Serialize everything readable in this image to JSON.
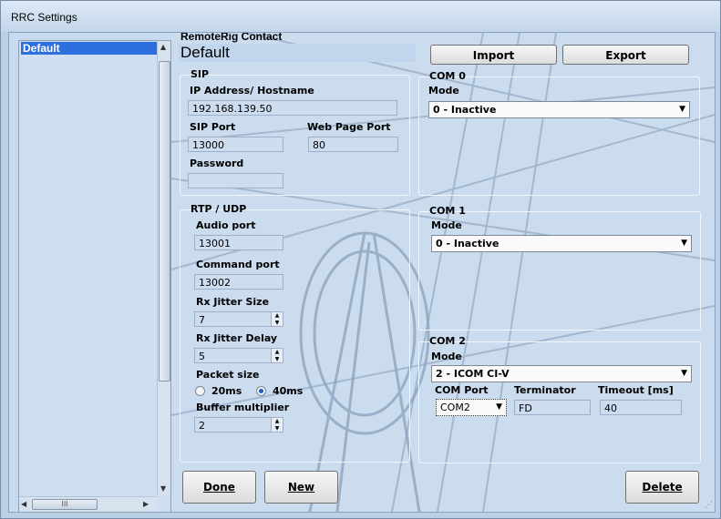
{
  "window": {
    "title": "RRC Settings"
  },
  "list": {
    "items": [
      {
        "label": "Default",
        "selected": true
      }
    ],
    "hscroll_glyph": "III"
  },
  "header": {
    "contact_label": "RemoteRig Contact",
    "profile_name": "Default"
  },
  "buttons": {
    "import": "Import",
    "export": "Export",
    "done": "Done",
    "new": "New",
    "delete": "Delete"
  },
  "sip": {
    "title": "SIP",
    "ip_label": "IP Address/ Hostname",
    "ip_value": "192.168.139.50",
    "sip_port_label": "SIP Port",
    "sip_port_value": "13000",
    "web_port_label": "Web Page Port",
    "web_port_value": "80",
    "password_label": "Password",
    "password_value": ""
  },
  "rtp": {
    "title": "RTP / UDP",
    "audio_port_label": "Audio port",
    "audio_port_value": "13001",
    "command_port_label": "Command port",
    "command_port_value": "13002",
    "rx_jitter_size_label": "Rx Jitter Size",
    "rx_jitter_size_value": "7",
    "rx_jitter_delay_label": "Rx Jitter Delay",
    "rx_jitter_delay_value": "5",
    "packet_size_label": "Packet size",
    "packet_20_label": "20ms",
    "packet_40_label": "40ms",
    "packet_selected": "40ms",
    "buffer_multiplier_label": "Buffer multiplier",
    "buffer_multiplier_value": "2"
  },
  "com0": {
    "title": "COM 0",
    "mode_label": "Mode",
    "mode_value": "0 - Inactive"
  },
  "com1": {
    "title": "COM 1",
    "mode_label": "Mode",
    "mode_value": "0 - Inactive"
  },
  "com2": {
    "title": "COM 2",
    "mode_label": "Mode",
    "mode_value": "2 - ICOM CI-V",
    "com_port_label": "COM Port",
    "com_port_value": "COM2",
    "terminator_label": "Terminator",
    "terminator_value": "FD",
    "timeout_label": "Timeout [ms]",
    "timeout_value": "40"
  },
  "colors": {
    "selection": "#2e6fe0",
    "background": "#c8daef"
  }
}
